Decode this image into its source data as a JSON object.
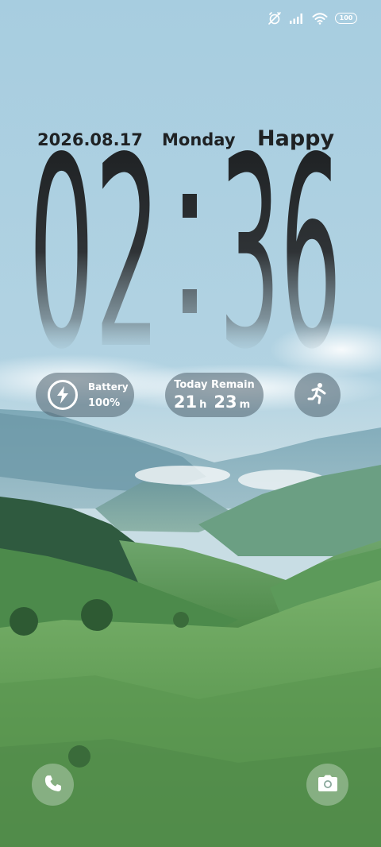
{
  "status_bar": {
    "icons": [
      "alarm-off-icon",
      "signal-icon",
      "wifi-icon",
      "battery-icon"
    ],
    "battery_level": "100"
  },
  "lock_screen": {
    "date": "2026.08.17",
    "weekday": "Monday",
    "greeting": "Happy",
    "clock": {
      "hours": "02",
      "minutes": "36",
      "separator": ":"
    }
  },
  "widgets": {
    "battery": {
      "label": "Battery",
      "value": "100%",
      "icon": "lightning-bolt-icon"
    },
    "today_remain": {
      "title": "Today Remain",
      "hours": "21",
      "hours_unit": "h",
      "minutes": "23",
      "minutes_unit": "m"
    },
    "activity": {
      "icon": "running-person-icon"
    }
  },
  "shortcuts": {
    "left": "phone-icon",
    "right": "camera-icon"
  },
  "colors": {
    "sky": "#a9cfe1",
    "clock_text": "#1f2224",
    "widget_bg": "#546874",
    "grass": "#5d9b56"
  }
}
